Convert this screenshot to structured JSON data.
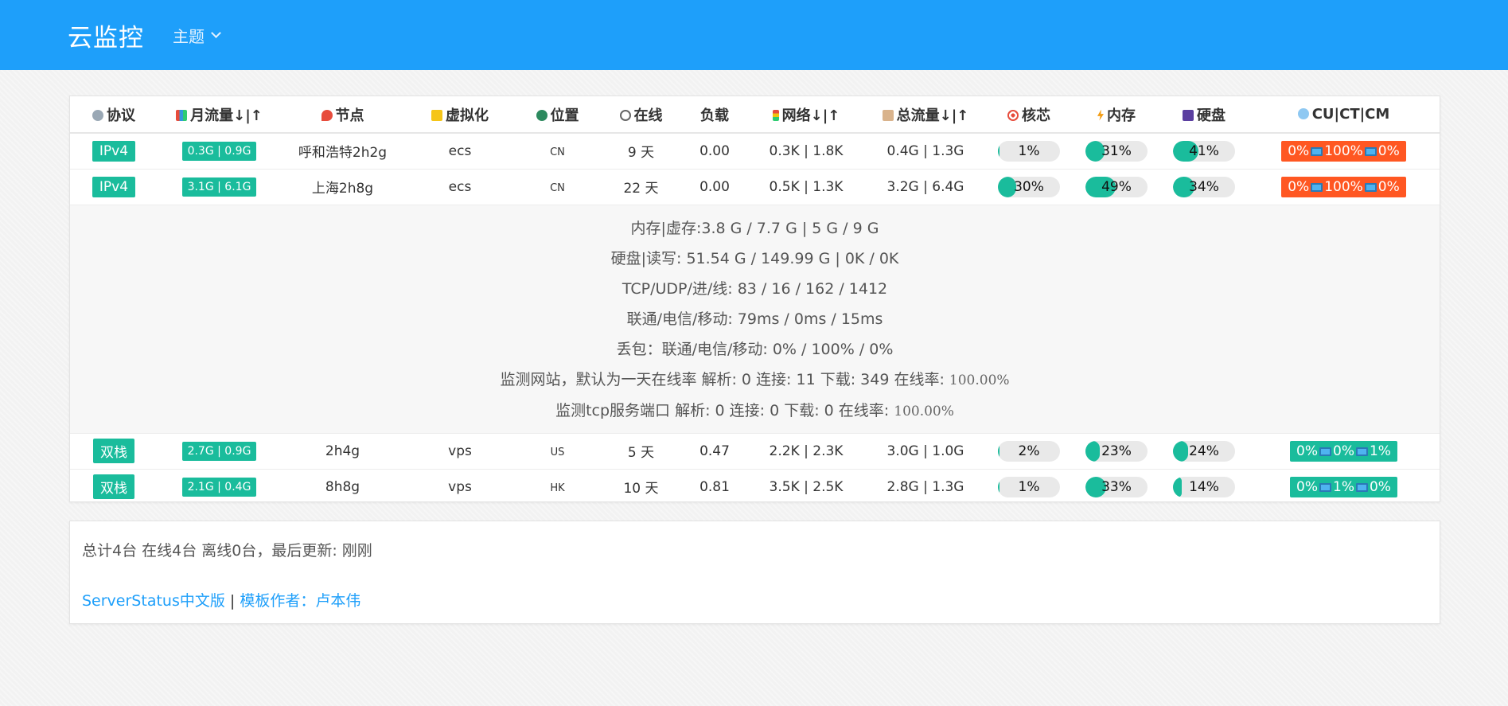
{
  "navbar": {
    "brand": "云监控",
    "theme": "主题"
  },
  "headers": {
    "protocol": "协议",
    "monthly": "月流量↓|↑",
    "node": "节点",
    "virt": "虚拟化",
    "location": "位置",
    "online": "在线",
    "load": "负载",
    "network": "网络↓|↑",
    "total": "总流量↓|↑",
    "cpu": "核芯",
    "mem": "内存",
    "hdd": "硬盘",
    "ping": "CU|CT|CM"
  },
  "icons": {
    "protocol": "link-icon",
    "monthly": "bar-chart-icon",
    "node": "pushpin-icon",
    "virt": "folder-icon",
    "location": "globe-icon",
    "online": "stopwatch-icon",
    "network": "traffic-light-icon",
    "total": "clipboard-icon",
    "cpu": "target-icon",
    "mem": "lightning-icon",
    "hdd": "floppy-disk-icon",
    "ping": "globe-grid-icon",
    "isp": "laptop-icon"
  },
  "colors": {
    "primary": "#1e9ffa",
    "teal": "#1abc9c",
    "alert": "#ff5722"
  },
  "rows": [
    {
      "protocol": "IPv4",
      "monthly": "0.3G | 0.9G",
      "node": "呼和浩特2h2g",
      "virt": "ecs",
      "location": "CN",
      "online": "9 天",
      "load": "0.00",
      "network": "0.3K | 1.8K",
      "total": "0.4G | 1.3G",
      "cpu": "1%",
      "cpu_v": 1,
      "mem": "31%",
      "mem_v": 31,
      "hdd": "41%",
      "hdd_v": 41,
      "cu": "0%",
      "ct": "100%",
      "cm": "0%",
      "ping_status": "bad"
    },
    {
      "protocol": "IPv4",
      "monthly": "3.1G | 6.1G",
      "node": "上海2h8g",
      "virt": "ecs",
      "location": "CN",
      "online": "22 天",
      "load": "0.00",
      "network": "0.5K | 1.3K",
      "total": "3.2G | 6.4G",
      "cpu": "30%",
      "cpu_v": 30,
      "mem": "49%",
      "mem_v": 49,
      "hdd": "34%",
      "hdd_v": 34,
      "cu": "0%",
      "ct": "100%",
      "cm": "0%",
      "ping_status": "bad"
    },
    {
      "protocol": "双栈",
      "monthly": "2.7G | 0.9G",
      "node": "2h4g",
      "virt": "vps",
      "location": "US",
      "online": "5 天",
      "load": "0.47",
      "network": "2.2K | 2.3K",
      "total": "3.0G | 1.0G",
      "cpu": "2%",
      "cpu_v": 2,
      "mem": "23%",
      "mem_v": 23,
      "hdd": "24%",
      "hdd_v": 24,
      "cu": "0%",
      "ct": "0%",
      "cm": "1%",
      "ping_status": "good"
    },
    {
      "protocol": "双栈",
      "monthly": "2.1G | 0.4G",
      "node": "8h8g",
      "virt": "vps",
      "location": "HK",
      "online": "10 天",
      "load": "0.81",
      "network": "3.5K | 2.5K",
      "total": "2.8G | 1.3G",
      "cpu": "1%",
      "cpu_v": 1,
      "mem": "33%",
      "mem_v": 33,
      "hdd": "14%",
      "hdd_v": 14,
      "cu": "0%",
      "ct": "1%",
      "cm": "0%",
      "ping_status": "good"
    }
  ],
  "detail": {
    "mem": "内存|虚存:3.8 G / 7.7 G | 5 G / 9 G",
    "disk": "硬盘|读写: 51.54 G / 149.99 G | 0K / 0K",
    "tcp": "TCP/UDP/进/线: 83 / 16 / 162 / 1412",
    "latency": "联通/电信/移动: 79ms / 0ms / 15ms",
    "loss": "丢包：联通/电信/移动: 0% / 100% / 0%",
    "web": "监测网站，默认为一天在线率 解析: 0 连接: 11 下载: 349 在线率:",
    "web_rate": "100.00%",
    "tcpsvc": "监测tcp服务端口 解析: 0 连接: 0 下载: 0 在线率:",
    "tcpsvc_rate": "100.00%"
  },
  "footer": {
    "summary": "总计4台 在线4台 离线0台，最后更新: 刚刚",
    "link1": "ServerStatus中文版",
    "sep": " | ",
    "link2": "模板作者：卢本伟"
  }
}
